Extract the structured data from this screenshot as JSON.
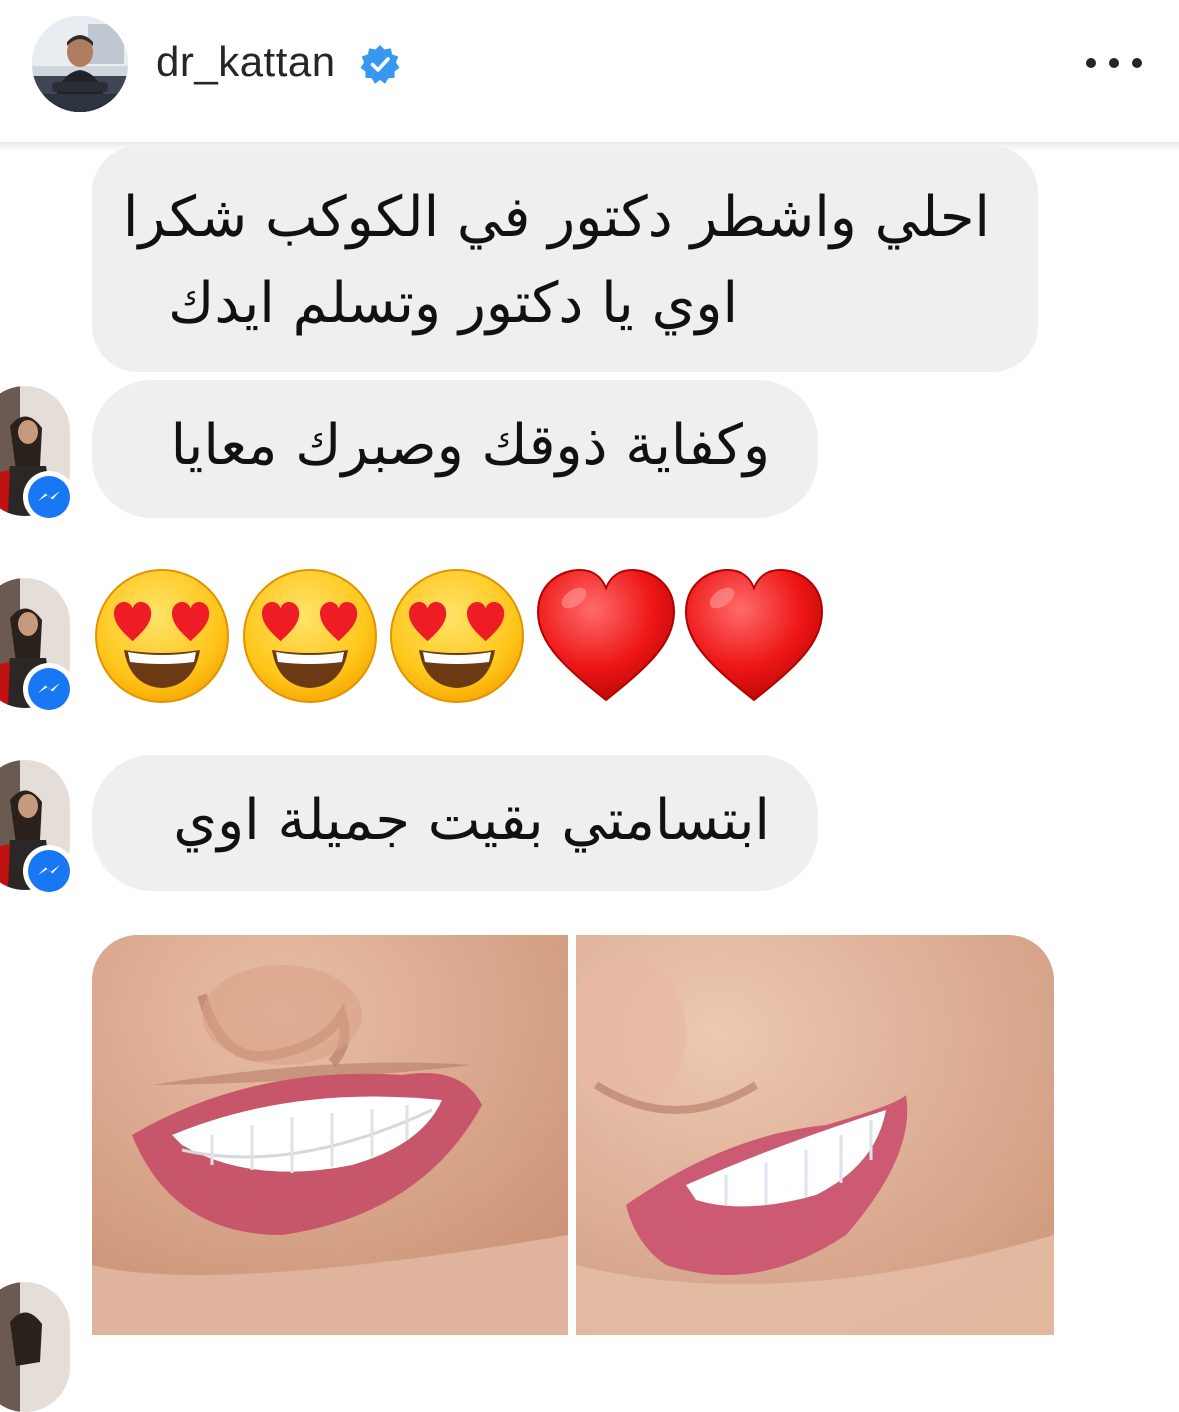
{
  "header": {
    "username": "dr_kattan",
    "verified_icon": "verified-badge-icon",
    "more_icon": "more-options-icon"
  },
  "messages": [
    {
      "line1": "احلي واشطر دكتور في الكوكب شكرا",
      "line2": "اوي يا دكتور وتسلم ايدك"
    },
    {
      "text": "وكفاية ذوقك وصبرك معايا"
    },
    {
      "emojis": [
        "heart-eyes-face",
        "heart-eyes-face",
        "heart-eyes-face",
        "red-heart",
        "red-heart"
      ]
    },
    {
      "text": "ابتسامتي بقيت جميلة اوي"
    },
    {
      "photos": [
        "smile-photo-before",
        "smile-photo-after"
      ]
    }
  ],
  "colors": {
    "bubble": "#efefef",
    "verified": "#3897f0",
    "messenger": "#1877f2"
  }
}
